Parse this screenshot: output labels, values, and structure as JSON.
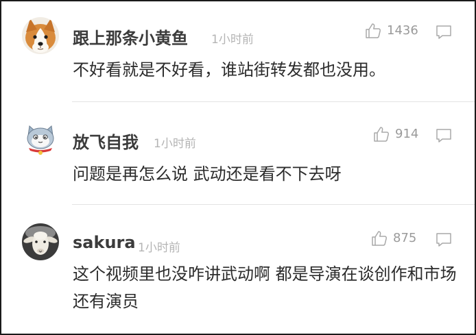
{
  "comments": [
    {
      "username": "跟上那条小黄鱼",
      "time": "1小时前",
      "likes": "1436",
      "content": "不好看就是不好看，谁站街转发都也没用。",
      "avatar": "corgi-dog-avatar"
    },
    {
      "username": "放飞自我",
      "time": "1小时前",
      "likes": "914",
      "content": "问题是再怎么说 武动还是看不下去呀",
      "avatar": "cartoon-cat-avatar"
    },
    {
      "username": "sakura",
      "time": "1小时前",
      "likes": "875",
      "content": "这个视频里也没咋讲武动啊 都是导演在谈创作和市场还有演员",
      "avatar": "sheep-avatar"
    }
  ],
  "icons": {
    "like": "thumbs-up-icon",
    "reply": "speech-bubble-icon"
  },
  "colors": {
    "username": "#3b3b3b",
    "meta": "#b4b4b4",
    "count": "#9a9a9a",
    "text": "#2b2b2b",
    "divider": "#e3e3e3"
  }
}
